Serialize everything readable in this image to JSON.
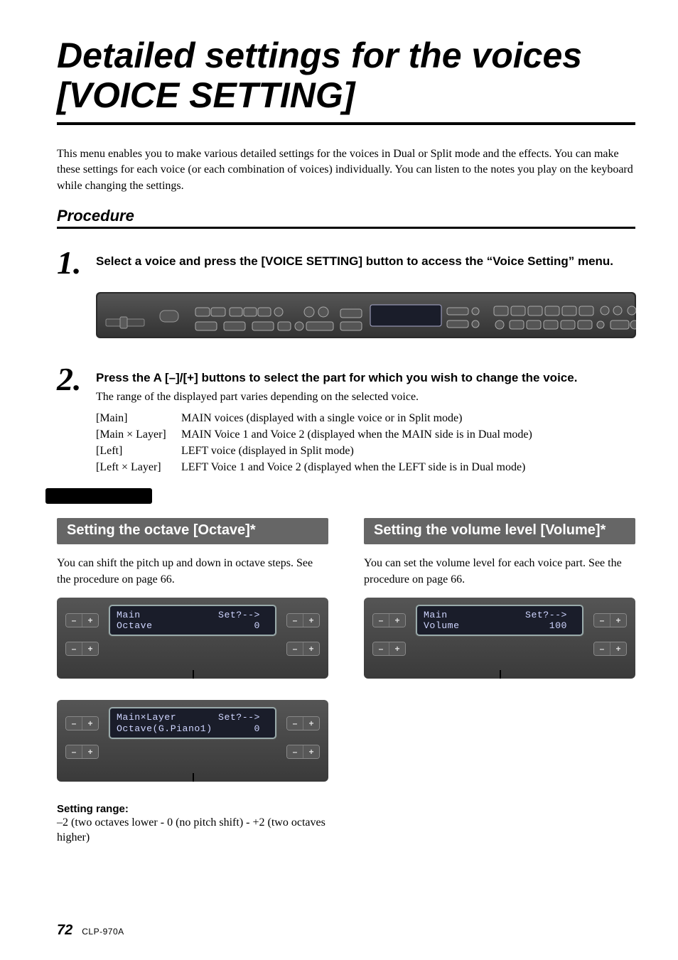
{
  "title": "Detailed settings for the voices [VOICE SETTING]",
  "intro": "This menu enables you to make various detailed settings for the voices in Dual or Split mode and the effects. You can make these settings for each voice (or each combination of voices) individually. You can listen to the notes you play on the keyboard while changing the settings.",
  "procedure_heading": "Procedure",
  "steps": [
    {
      "num": "1.",
      "title": "Select a voice and press the [VOICE SETTING] button to access the “Voice Setting” menu."
    },
    {
      "num": "2.",
      "title": "Press the A [–]/[+] buttons to select the part for which you wish to change the voice.",
      "desc": "The range of the displayed part varies depending on the selected voice.",
      "parts": [
        {
          "k": "[Main]",
          "v": "MAIN voices (displayed with a single voice or in Split mode)"
        },
        {
          "k": "[Main × Layer]",
          "v": "MAIN Voice 1 and Voice 2 (displayed when the MAIN side is in Dual mode)"
        },
        {
          "k": "[Left]",
          "v": "LEFT voice (displayed in Split mode)"
        },
        {
          "k": "[Left × Layer]",
          "v": "LEFT Voice 1 and Voice 2 (displayed when the LEFT side is in Dual mode)"
        }
      ]
    }
  ],
  "octave": {
    "heading": "Setting the octave [Octave]*",
    "text": "You can shift the pitch up and down in octave steps. See the procedure on page 66.",
    "lcd1_line1": "Main             Set?-->",
    "lcd1_line2": "Octave                 0",
    "lcd2_line1": "Main×Layer       Set?-->",
    "lcd2_line2": "Octave(G.Piano1)       0",
    "range_label": "Setting range:",
    "range_text": "–2 (two octaves lower - 0 (no pitch shift) - +2 (two octaves higher)"
  },
  "volume": {
    "heading": "Setting the volume level [Volume]*",
    "text": "You can set the volume level for each voice part. See the procedure on page 66.",
    "lcd_line1": "Main             Set?-->",
    "lcd_line2": "Volume               100"
  },
  "btn_minus": "–",
  "btn_plus": "+",
  "footer": {
    "page": "72",
    "model": "CLP-970A"
  }
}
